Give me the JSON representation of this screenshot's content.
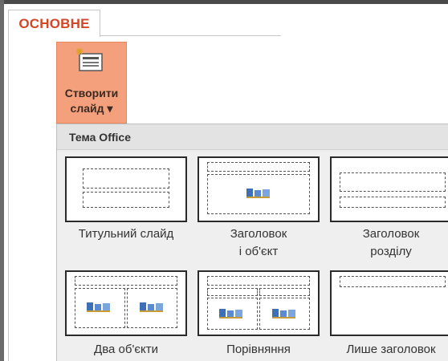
{
  "ribbon": {
    "tab_label": "ОСНОВНЕ",
    "new_slide_label_line1": "Створити",
    "new_slide_label_line2": "слайд ▾"
  },
  "gallery": {
    "header": "Тема Office",
    "layouts": [
      {
        "label": "Титульний слайд",
        "label2": ""
      },
      {
        "label": "Заголовок",
        "label2": "і об'єкт"
      },
      {
        "label": "Заголовок",
        "label2": "розділу"
      },
      {
        "label": "Два об'єкти",
        "label2": ""
      },
      {
        "label": "Порівняння",
        "label2": ""
      },
      {
        "label": "Лише заголовок",
        "label2": ""
      }
    ]
  },
  "colors": {
    "accent": "#d24726",
    "button_active": "#f4a07c"
  },
  "icons": [
    "new-slide-icon",
    "content-placeholder-icon"
  ]
}
